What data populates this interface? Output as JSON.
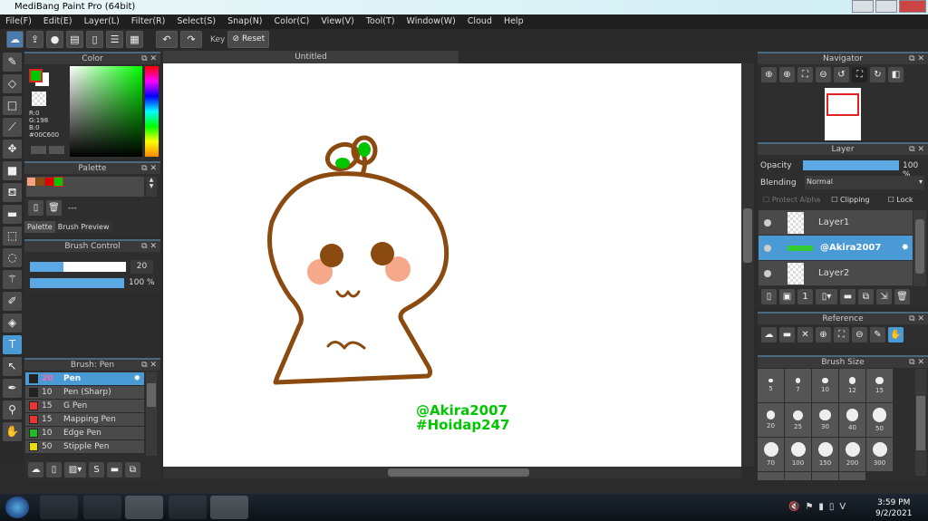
{
  "window": {
    "title": "MediBang Paint Pro (64bit)"
  },
  "menu": [
    "File(F)",
    "Edit(E)",
    "Layer(L)",
    "Filter(R)",
    "Select(S)",
    "Snap(N)",
    "Color(C)",
    "View(V)",
    "Tool(T)",
    "Window(W)",
    "Cloud",
    "Help"
  ],
  "toolbar": {
    "key_label": "Key",
    "reset_label": "Reset"
  },
  "color_panel": {
    "title": "Color",
    "r": "R:0",
    "g": "G:198",
    "b": "B:0",
    "hex": "#00C600",
    "fg": "#00c600",
    "bg": "#ffffff"
  },
  "palette_panel": {
    "title": "Palette",
    "swatches": [
      "#f6a27e",
      "#8b4a10",
      "#e00000",
      "#00c600"
    ],
    "name": "---",
    "tabs": [
      "Palette",
      "Brush Preview"
    ]
  },
  "brush_control": {
    "title": "Brush Control",
    "size": "20",
    "opacity": "100 %",
    "size_fraction": 0.35,
    "opacity_fraction": 1.0
  },
  "brush_panel": {
    "title": "Brush: Pen",
    "items": [
      {
        "size": "20",
        "name": "Pen",
        "color": "#222222"
      },
      {
        "size": "10",
        "name": "Pen (Sharp)",
        "color": "#222222"
      },
      {
        "size": "15",
        "name": "G Pen",
        "color": "#ee3333"
      },
      {
        "size": "15",
        "name": "Mapping Pen",
        "color": "#ee3333"
      },
      {
        "size": "10",
        "name": "Edge Pen",
        "color": "#22bb22"
      },
      {
        "size": "50",
        "name": "Stipple Pen",
        "color": "#eedd00"
      }
    ]
  },
  "canvas": {
    "tab": "Untitled",
    "text1": "@Akira2007",
    "text2": "#Hoidap247",
    "line_color": "#8b4a10",
    "cheek_color": "#f6a98a",
    "leaf_color": "#00c600"
  },
  "navigator": {
    "title": "Navigator"
  },
  "layer_panel": {
    "title": "Layer",
    "opacity_label": "Opacity",
    "opacity": "100 %",
    "blending_label": "Blending",
    "blending": "Normal",
    "protect_alpha": "Protect Alpha",
    "clipping": "Clipping",
    "lock": "Lock",
    "layers": [
      {
        "name": "Layer1"
      },
      {
        "name": "@Akira2007",
        "selected": true
      },
      {
        "name": "Layer2"
      }
    ]
  },
  "reference": {
    "title": "Reference"
  },
  "brush_size": {
    "title": "Brush Size",
    "sizes": [
      "5",
      "7",
      "10",
      "12",
      "15",
      "20",
      "25",
      "30",
      "40",
      "50",
      "70",
      "100",
      "150",
      "200",
      "300"
    ]
  },
  "taskbar": {
    "time": "3:59 PM",
    "date": "9/2/2021"
  }
}
